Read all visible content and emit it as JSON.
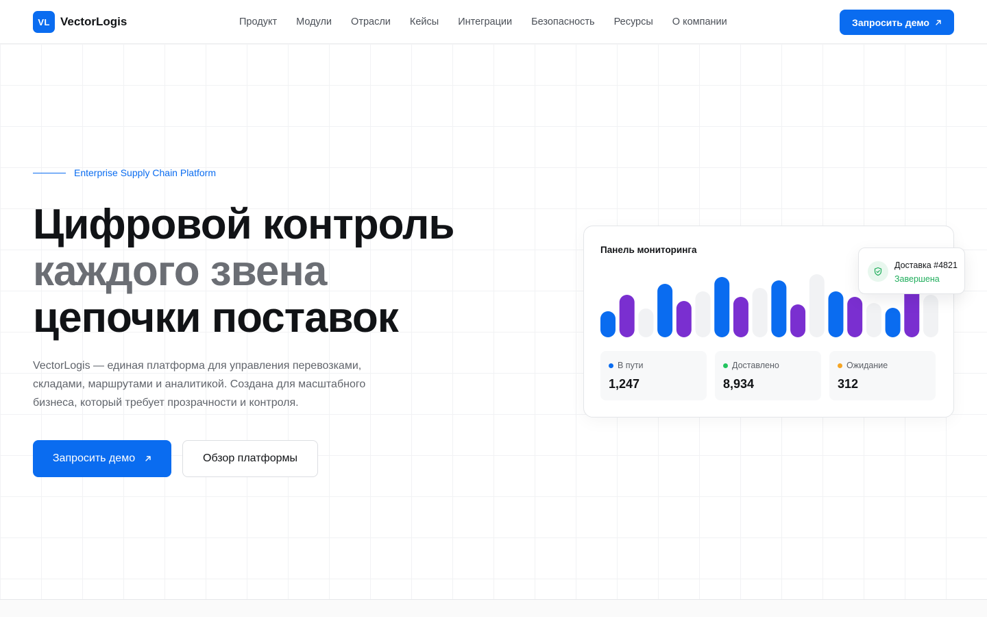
{
  "brand": {
    "mark": "VL",
    "name": "VectorLogis",
    "accent": "#0a6cf0"
  },
  "nav": {
    "items": [
      "Продукт",
      "Модули",
      "Отрасли",
      "Кейсы",
      "Интеграции",
      "Безопасность",
      "Ресурсы",
      "О компании"
    ]
  },
  "header": {
    "cta_label": "Запросить демо",
    "cta_icon": "arrow-up-right-icon"
  },
  "hero": {
    "eyebrow": "Enterprise Supply Chain Platform",
    "title_line1": "Цифровой контроль",
    "title_line2": "каждого звена",
    "title_line3": "цепочки поставок",
    "description": "VectorLogis — единая платформа для управления перевозками, складами, маршрутами и аналитикой. Создана для масштабного бизнеса, который требует прозрачности и контроля.",
    "primary_label": "Запросить демо",
    "secondary_label": "Обзор платформы"
  },
  "dashboard": {
    "title": "Панель мониторинга",
    "bar_colors": {
      "blue": "#0a6cf0",
      "purple": "#7a2fd0",
      "gray": "#f1f2f4"
    },
    "bars": [
      {
        "level": 0.38,
        "color": "blue"
      },
      {
        "level": 0.62,
        "color": "purple"
      },
      {
        "level": 0.42,
        "color": "gray"
      },
      {
        "level": 0.78,
        "color": "blue"
      },
      {
        "level": 0.53,
        "color": "purple"
      },
      {
        "level": 0.67,
        "color": "gray"
      },
      {
        "level": 0.88,
        "color": "blue"
      },
      {
        "level": 0.59,
        "color": "purple"
      },
      {
        "level": 0.72,
        "color": "gray"
      },
      {
        "level": 0.83,
        "color": "blue"
      },
      {
        "level": 0.48,
        "color": "purple"
      },
      {
        "level": 0.92,
        "color": "gray"
      },
      {
        "level": 0.67,
        "color": "blue"
      },
      {
        "level": 0.59,
        "color": "purple"
      },
      {
        "level": 0.5,
        "color": "gray"
      },
      {
        "level": 0.43,
        "color": "blue"
      },
      {
        "level": 0.75,
        "color": "purple"
      },
      {
        "level": 0.62,
        "color": "gray"
      }
    ],
    "stats": [
      {
        "label": "В пути",
        "value": "1,247",
        "dot": "#0a6cf0"
      },
      {
        "label": "Доставлено",
        "value": "8,934",
        "dot": "#22c35e"
      },
      {
        "label": "Ожидание",
        "value": "312",
        "dot": "#f5a524"
      }
    ]
  },
  "toast": {
    "title": "Доставка #4821",
    "status": "Завершена",
    "icon": "shield-check-icon",
    "status_color": "#1fad5b"
  }
}
